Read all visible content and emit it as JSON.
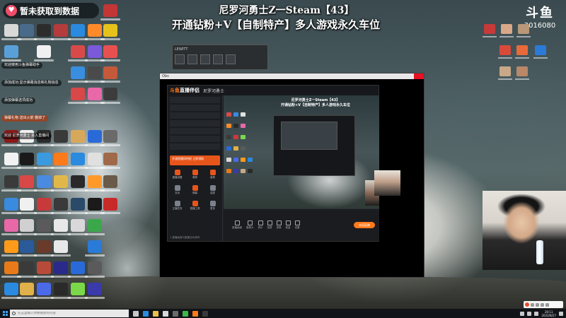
{
  "overlay": {
    "badge_text": "暂未获取到数据",
    "stream_title": "尼罗河勇士Z一Steam【43】",
    "stream_subtitle": "开通钻粉+V【自制特产】多人游戏永久车位"
  },
  "platform": {
    "logo_text": "斗鱼",
    "room_id": "3016080"
  },
  "chat_messages": [
    {
      "text": "欢迎使用斗鱼弹幕助手"
    },
    {
      "text": "添加成功:显示弹幕消息和礼物消息"
    },
    {
      "text": "添加弹幕选项成功"
    },
    {
      "text": "弹幕礼物 送出火箭 删掉了"
    },
    {
      "text": "欢迎 尼罗河勇士 进入直播间"
    }
  ],
  "widget": {
    "title": "LEWITT"
  },
  "main_window": {
    "title": "Obs",
    "app": {
      "logo_prefix": "斗鱼",
      "logo_suffix": "直播伴侣",
      "tab_label": "尼罗河勇士",
      "promo_text": "开通直播间特权 立即领取",
      "tools": [
        {
          "label": "直播设置"
        },
        {
          "label": "美颜"
        },
        {
          "label": "道具"
        },
        {
          "label": "互动"
        },
        {
          "label": "弹幕"
        },
        {
          "label": "连麦"
        },
        {
          "label": "主播任务"
        },
        {
          "label": "直播工具"
        },
        {
          "label": "更多"
        }
      ],
      "preview_title_line1": "尼罗河勇士Z一Steam【43】",
      "preview_title_line2": "开通钻粉+V【自制特产】多人游戏永久车位",
      "controls": [
        {
          "label": "直播画面"
        },
        {
          "label": "摄像头"
        },
        {
          "label": "音乐"
        },
        {
          "label": "投屏"
        },
        {
          "label": "录像"
        },
        {
          "label": "音量"
        },
        {
          "label": "设置"
        }
      ],
      "live_button": "关闭直播",
      "footer_text": "1.直播画面与直播互动说明"
    }
  },
  "taskbar": {
    "search_placeholder": "在这里输入你要搜索的内容",
    "time": "20:11",
    "date": "2022/8/27"
  },
  "colors": {
    "accent": "#ff7a1a",
    "badge_heart": "#f04c6a",
    "taskbar": "#101418"
  }
}
